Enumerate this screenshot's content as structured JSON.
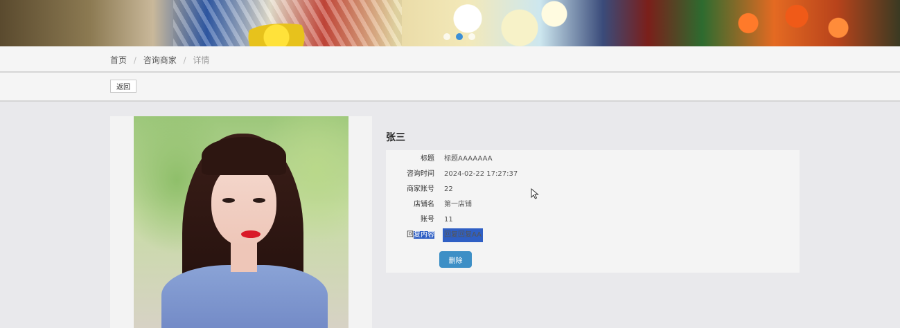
{
  "breadcrumb": {
    "home": "首页",
    "section": "咨询商家",
    "current": "详情",
    "separator": "/"
  },
  "toolbar": {
    "back_label": "返回"
  },
  "detail": {
    "name": "张三",
    "fields": [
      {
        "label": "标题",
        "value": "标题AAAAAAA"
      },
      {
        "label": "咨询时间",
        "value": "2024-02-22 17:27:37"
      },
      {
        "label": "商家账号",
        "value": "22"
      },
      {
        "label": "店铺名",
        "value": "第一店铺"
      },
      {
        "label": "账号",
        "value": "11"
      }
    ],
    "reply": {
      "label_plain": "回",
      "label_selected": "复内容",
      "value": "回复回复AA"
    },
    "delete_label": "删除"
  },
  "colors": {
    "accent": "#3d8fc6",
    "selection": "#2f5fc4",
    "carousel_active_dot": "#3b8fd6"
  },
  "icons": {
    "cursor": "mouse-pointer-icon"
  }
}
